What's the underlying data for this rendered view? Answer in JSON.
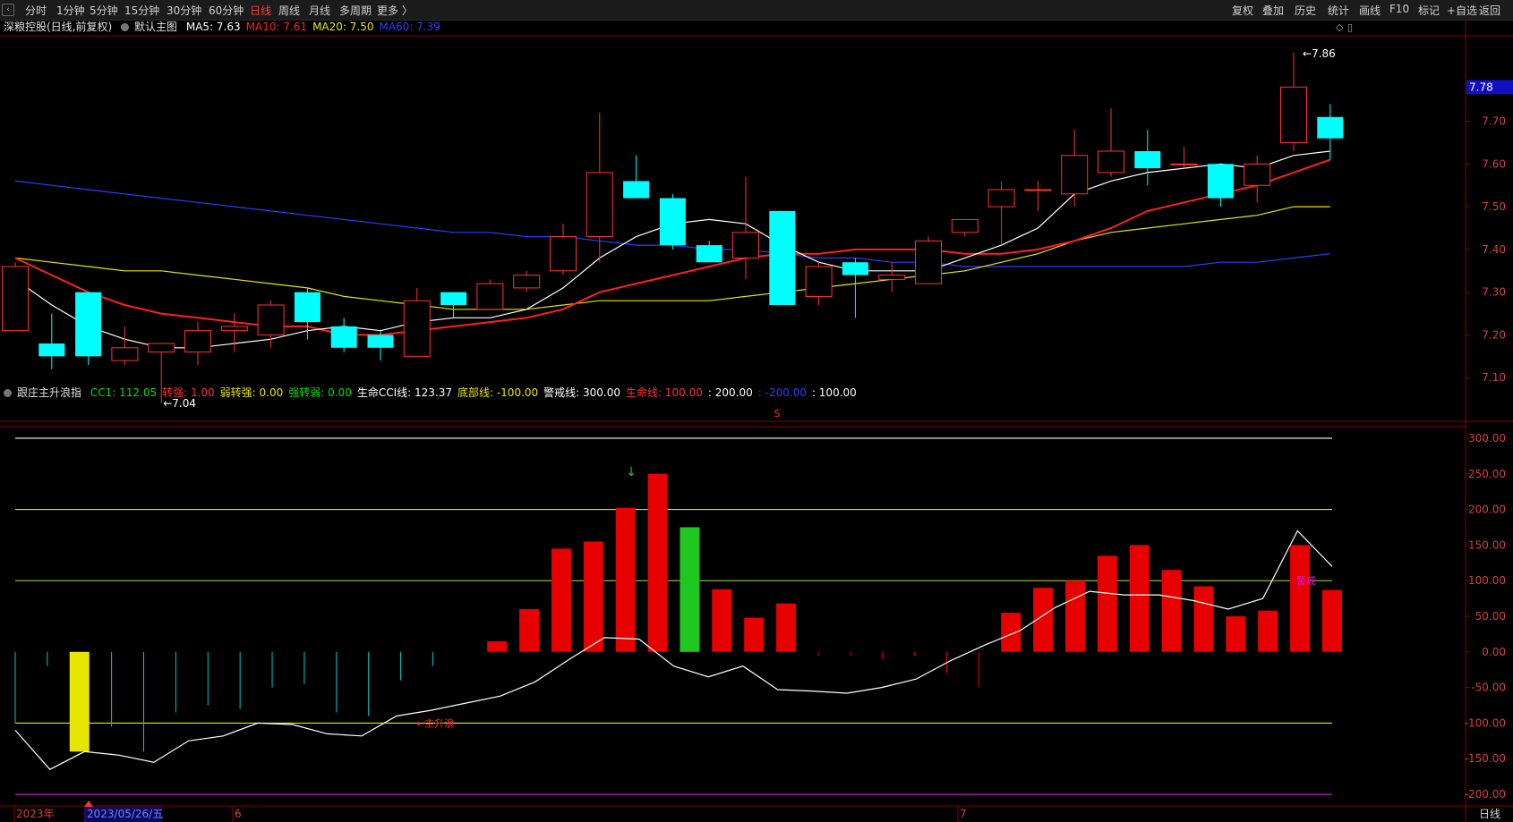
{
  "toolbar": {
    "nav_icon": "back-arrow-icon",
    "periods": [
      "分时",
      "1分钟",
      "5分钟",
      "15分钟",
      "30分钟",
      "60分钟",
      "日线",
      "周线",
      "月线",
      "多周期",
      "更多 〉"
    ],
    "active_period": "日线",
    "tools": [
      "复权",
      "叠加",
      "历史",
      "统计",
      "画线",
      "F10",
      "标记",
      "+自选",
      "返回"
    ]
  },
  "main_panel": {
    "stock": "深粮控股(日线,前复权)",
    "template": "默认主图",
    "ma": [
      {
        "label": "MA5: 7.63",
        "color": "#ffffff"
      },
      {
        "label": "MA10: 7.61",
        "color": "#ff2020"
      },
      {
        "label": "MA20: 7.50",
        "color": "#e6e600"
      },
      {
        "label": "MA60: 7.39",
        "color": "#2c3cff"
      }
    ],
    "last_price": "7.78",
    "high_label": "7.86",
    "low_label": "7.04",
    "s_marker": "S",
    "y_ticks": [
      "7.70",
      "7.60",
      "7.50",
      "7.40",
      "7.30",
      "7.20",
      "7.10"
    ]
  },
  "indicator_panel": {
    "name": "跟庄主升浪指",
    "legend": [
      {
        "label": "CC1: 112.05",
        "color": "#00e000"
      },
      {
        "label": "转强: 1.00",
        "color": "#ff3030"
      },
      {
        "label": "弱转强: 0.00",
        "color": "#e6e600"
      },
      {
        "label": "强转弱: 0.00",
        "color": "#00e000"
      },
      {
        "label": "生命CCI线: 123.37",
        "color": "#ffffff"
      },
      {
        "label": "底部线: -100.00",
        "color": "#e6e600"
      },
      {
        "label": "警戒线: 300.00",
        "color": "#ffffff"
      },
      {
        "label": "生命线: 100.00",
        "color": "#ff3030"
      },
      {
        "label": ": 200.00",
        "color": "#ffffff"
      },
      {
        "label": ": -200.00",
        "color": "#2c3cff"
      },
      {
        "label": ": 100.00",
        "color": "#ffffff"
      }
    ],
    "y_ticks": [
      "300.00",
      "250.00",
      "200.00",
      "150.00",
      "100.00",
      "50.00",
      "0.00",
      "-50.00",
      "-100.00",
      "-150.00",
      "-200.00"
    ],
    "annotation_main": "主升浪",
    "annotation_warn": "警戒"
  },
  "date_axis": {
    "labels": [
      "2023年",
      "2023/05/26/五",
      "6",
      "7"
    ],
    "mode": "日线"
  },
  "chart_data": [
    {
      "type": "candlestick",
      "title": "深粮控股(日线,前复权)",
      "ylim": [
        7.0,
        7.9
      ],
      "candles": [
        {
          "o": 7.21,
          "h": 7.37,
          "l": 7.21,
          "c": 7.36
        },
        {
          "o": 7.18,
          "h": 7.25,
          "l": 7.12,
          "c": 7.15
        },
        {
          "o": 7.3,
          "h": 7.3,
          "l": 7.13,
          "c": 7.15
        },
        {
          "o": 7.14,
          "h": 7.22,
          "l": 7.13,
          "c": 7.17
        },
        {
          "o": 7.16,
          "h": 7.18,
          "l": 7.04,
          "c": 7.18
        },
        {
          "o": 7.16,
          "h": 7.23,
          "l": 7.13,
          "c": 7.21
        },
        {
          "o": 7.21,
          "h": 7.25,
          "l": 7.16,
          "c": 7.22
        },
        {
          "o": 7.2,
          "h": 7.28,
          "l": 7.17,
          "c": 7.27
        },
        {
          "o": 7.3,
          "h": 7.31,
          "l": 7.19,
          "c": 7.23
        },
        {
          "o": 7.22,
          "h": 7.24,
          "l": 7.16,
          "c": 7.17
        },
        {
          "o": 7.2,
          "h": 7.21,
          "l": 7.14,
          "c": 7.17
        },
        {
          "o": 7.15,
          "h": 7.31,
          "l": 7.15,
          "c": 7.28
        },
        {
          "o": 7.3,
          "h": 7.3,
          "l": 7.24,
          "c": 7.27
        },
        {
          "o": 7.26,
          "h": 7.33,
          "l": 7.26,
          "c": 7.32
        },
        {
          "o": 7.31,
          "h": 7.35,
          "l": 7.3,
          "c": 7.34
        },
        {
          "o": 7.35,
          "h": 7.46,
          "l": 7.34,
          "c": 7.43
        },
        {
          "o": 7.43,
          "h": 7.72,
          "l": 7.37,
          "c": 7.58
        },
        {
          "o": 7.56,
          "h": 7.62,
          "l": 7.52,
          "c": 7.52
        },
        {
          "o": 7.52,
          "h": 7.53,
          "l": 7.4,
          "c": 7.41
        },
        {
          "o": 7.41,
          "h": 7.42,
          "l": 7.37,
          "c": 7.37
        },
        {
          "o": 7.38,
          "h": 7.57,
          "l": 7.33,
          "c": 7.44
        },
        {
          "o": 7.49,
          "h": 7.49,
          "l": 7.27,
          "c": 7.27
        },
        {
          "o": 7.29,
          "h": 7.37,
          "l": 7.27,
          "c": 7.36
        },
        {
          "o": 7.37,
          "h": 7.38,
          "l": 7.24,
          "c": 7.34
        },
        {
          "o": 7.33,
          "h": 7.37,
          "l": 7.3,
          "c": 7.34
        },
        {
          "o": 7.32,
          "h": 7.43,
          "l": 7.32,
          "c": 7.42
        },
        {
          "o": 7.44,
          "h": 7.47,
          "l": 7.43,
          "c": 7.47
        },
        {
          "o": 7.5,
          "h": 7.56,
          "l": 7.41,
          "c": 7.54
        },
        {
          "o": 7.54,
          "h": 7.56,
          "l": 7.49,
          "c": 7.54
        },
        {
          "o": 7.53,
          "h": 7.68,
          "l": 7.5,
          "c": 7.62
        },
        {
          "o": 7.58,
          "h": 7.73,
          "l": 7.57,
          "c": 7.63
        },
        {
          "o": 7.63,
          "h": 7.68,
          "l": 7.55,
          "c": 7.59
        },
        {
          "o": 7.6,
          "h": 7.64,
          "l": 7.59,
          "c": 7.6
        },
        {
          "o": 7.6,
          "h": 7.6,
          "l": 7.5,
          "c": 7.52
        },
        {
          "o": 7.55,
          "h": 7.62,
          "l": 7.51,
          "c": 7.6
        },
        {
          "o": 7.65,
          "h": 7.86,
          "l": 7.63,
          "c": 7.78
        },
        {
          "o": 7.71,
          "h": 7.74,
          "l": 7.61,
          "c": 7.66
        }
      ],
      "ma5": [
        7.33,
        7.27,
        7.22,
        7.19,
        7.17,
        7.17,
        7.18,
        7.19,
        7.21,
        7.22,
        7.21,
        7.23,
        7.24,
        7.24,
        7.26,
        7.31,
        7.38,
        7.43,
        7.46,
        7.47,
        7.46,
        7.41,
        7.37,
        7.35,
        7.35,
        7.35,
        7.38,
        7.41,
        7.45,
        7.53,
        7.56,
        7.58,
        7.59,
        7.6,
        7.59,
        7.62,
        7.63
      ],
      "ma10": [
        7.38,
        7.34,
        7.3,
        7.27,
        7.25,
        7.24,
        7.23,
        7.22,
        7.22,
        7.2,
        7.2,
        7.21,
        7.22,
        7.23,
        7.24,
        7.26,
        7.3,
        7.32,
        7.34,
        7.36,
        7.38,
        7.39,
        7.39,
        7.4,
        7.4,
        7.4,
        7.39,
        7.39,
        7.4,
        7.42,
        7.45,
        7.49,
        7.51,
        7.53,
        7.55,
        7.58,
        7.61
      ],
      "ma20": [
        7.38,
        7.37,
        7.36,
        7.35,
        7.35,
        7.34,
        7.33,
        7.32,
        7.31,
        7.29,
        7.28,
        7.27,
        7.26,
        7.26,
        7.26,
        7.27,
        7.28,
        7.28,
        7.28,
        7.28,
        7.29,
        7.3,
        7.31,
        7.32,
        7.33,
        7.34,
        7.35,
        7.37,
        7.39,
        7.42,
        7.44,
        7.45,
        7.46,
        7.47,
        7.48,
        7.5,
        7.5
      ],
      "ma60": [
        7.56,
        7.55,
        7.54,
        7.53,
        7.52,
        7.51,
        7.5,
        7.49,
        7.48,
        7.47,
        7.46,
        7.45,
        7.44,
        7.44,
        7.43,
        7.43,
        7.42,
        7.41,
        7.41,
        7.4,
        7.4,
        7.39,
        7.38,
        7.38,
        7.37,
        7.37,
        7.36,
        7.36,
        7.36,
        7.36,
        7.36,
        7.36,
        7.36,
        7.37,
        7.37,
        7.38,
        7.39
      ]
    },
    {
      "type": "bar",
      "title": "跟庄主升浪指",
      "ylim": [
        -215,
        315
      ],
      "cc1": [
        -100,
        -20,
        -140,
        -105,
        -140,
        -85,
        -75,
        -80,
        -50,
        -45,
        -85,
        -90,
        -40,
        -20,
        0,
        15,
        60,
        145,
        155,
        202,
        250,
        175,
        88,
        48,
        68,
        -5,
        -5,
        -10,
        -5,
        -30,
        -50,
        55,
        90,
        100,
        135,
        150,
        115,
        92,
        50,
        58,
        150,
        87
      ],
      "bar_colors": [
        "cyan",
        "cyan",
        "yellow",
        "cyan",
        "cyan",
        "cyan",
        "cyan",
        "cyan",
        "cyan",
        "cyan",
        "cyan",
        "cyan",
        "cyan",
        "cyan",
        "red",
        "red",
        "red",
        "red",
        "red",
        "red",
        "red",
        "green",
        "red",
        "red",
        "red",
        "thin",
        "thin",
        "thin",
        "thin",
        "thin",
        "thin",
        "red",
        "red",
        "red",
        "red",
        "red",
        "red",
        "red",
        "red",
        "red",
        "red",
        "red"
      ],
      "cci_line": [
        -110,
        -165,
        -140,
        -145,
        -155,
        -125,
        -118,
        -100,
        -102,
        -115,
        -118,
        -90,
        -82,
        -72,
        -62,
        -42,
        -10,
        20,
        18,
        -20,
        -35,
        -20,
        -53,
        -55,
        -58,
        -50,
        -38,
        -12,
        10,
        30,
        62,
        85,
        80,
        80,
        72,
        60,
        75,
        170,
        120
      ]
    }
  ]
}
